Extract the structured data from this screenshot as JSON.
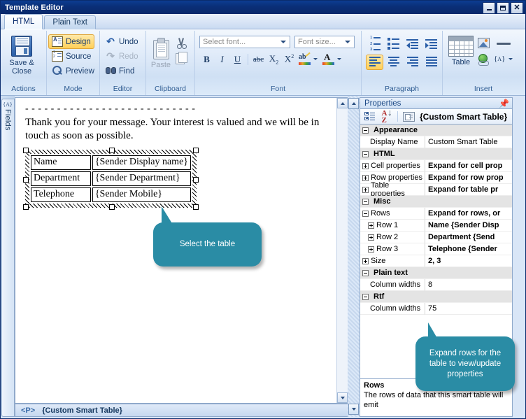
{
  "window": {
    "title": "Template Editor",
    "minimize_label": "Minimize",
    "maximize_label": "Maximize",
    "close_label": "Close"
  },
  "tabs": [
    {
      "label": "HTML",
      "active": true
    },
    {
      "label": "Plain Text",
      "active": false
    }
  ],
  "ribbon": {
    "groups": [
      {
        "label": "Actions",
        "buttons": [
          {
            "label": "Save &\nClose",
            "icon": "floppy-disk-icon"
          }
        ]
      },
      {
        "label": "Mode",
        "buttons": [
          {
            "label": "Design",
            "icon": "design-view-icon",
            "selected": true
          },
          {
            "label": "Source",
            "icon": "source-view-icon",
            "selected": false
          },
          {
            "label": "Preview",
            "icon": "magnifier-icon",
            "selected": false
          }
        ]
      },
      {
        "label": "Editor",
        "buttons": [
          {
            "label": "Undo",
            "icon": "undo-arrow-icon",
            "disabled": false
          },
          {
            "label": "Redo",
            "icon": "redo-arrow-icon",
            "disabled": true
          },
          {
            "label": "Find",
            "icon": "binoculars-icon",
            "disabled": false
          }
        ]
      },
      {
        "label": "Clipboard",
        "buttons": [
          {
            "label": "Paste",
            "icon": "clipboard-icon",
            "disabled": true
          },
          {
            "label": "",
            "icon": "scissors-icon"
          },
          {
            "label": "",
            "icon": "copy-icon"
          }
        ]
      },
      {
        "label": "Font",
        "font_name_placeholder": "Select font...",
        "font_size_placeholder": "Font size...",
        "buttons": [
          {
            "label": "B",
            "icon": "bold-icon"
          },
          {
            "label": "I",
            "icon": "italic-icon"
          },
          {
            "label": "U",
            "icon": "underline-icon"
          },
          {
            "label": "abc",
            "icon": "strikethrough-icon"
          },
          {
            "label": "X2",
            "icon": "subscript-icon"
          },
          {
            "label": "X2",
            "icon": "superscript-icon"
          },
          {
            "label": "",
            "icon": "highlight-color-icon"
          },
          {
            "label": "A",
            "icon": "font-color-icon"
          }
        ]
      },
      {
        "label": "Paragraph",
        "buttons": [
          {
            "icon": "numbered-list-icon"
          },
          {
            "icon": "bulleted-list-icon"
          },
          {
            "icon": "decrease-indent-icon"
          },
          {
            "icon": "increase-indent-icon"
          },
          {
            "icon": "align-left-icon",
            "selected": true
          },
          {
            "icon": "align-center-icon"
          },
          {
            "icon": "align-right-icon"
          },
          {
            "icon": "align-justify-icon"
          }
        ]
      },
      {
        "label": "Insert",
        "table_label": "Table",
        "buttons": [
          {
            "icon": "insert-table-icon",
            "label": "Table"
          },
          {
            "icon": "insert-image-icon"
          },
          {
            "icon": "horizontal-rule-icon"
          },
          {
            "icon": "insert-hyperlink-icon"
          },
          {
            "icon": "insert-field-icon",
            "label": "{A}"
          }
        ]
      }
    ]
  },
  "fields_rail": {
    "label": "Fields",
    "icon_label": "{A}"
  },
  "document": {
    "divider": "- - - - - - - - - - - - - - - - - - - - - - - - - - -",
    "paragraph": "Thank you for your message.  Your interest is valued and we will be in touch as soon as possible.",
    "table": {
      "rows": [
        {
          "label": "Name",
          "value": "{Sender Display name}"
        },
        {
          "label": "Department",
          "value": "{Sender Department}"
        },
        {
          "label": "Telephone",
          "value": "{Sender Mobile}"
        }
      ]
    }
  },
  "callouts": [
    {
      "id": "callout1",
      "text": "Select the table",
      "color": "#2a8ca5"
    },
    {
      "id": "callout2",
      "text": "Expand rows for the table to view/update properties",
      "color": "#2a8ca5"
    }
  ],
  "status_bar": {
    "element_tag": "<P>",
    "selection": "{Custom Smart Table}"
  },
  "properties_panel": {
    "title": "Properties",
    "pin_label": "Auto Hide",
    "toolbar": {
      "categorized_label": "Categorized",
      "alphabetical_label": "Alphabetical",
      "pages_label": "Property Pages"
    },
    "object_name": "{Custom Smart Table}",
    "grid": [
      {
        "kind": "category",
        "expander": "minus",
        "name": "Appearance"
      },
      {
        "kind": "prop",
        "expander": "none",
        "name": "Display Name",
        "value": "Custom Smart Table",
        "bold": false
      },
      {
        "kind": "category",
        "expander": "minus",
        "name": "HTML"
      },
      {
        "kind": "prop",
        "expander": "plus",
        "name": "Cell properties",
        "value": "Expand for cell prop",
        "bold": true
      },
      {
        "kind": "prop",
        "expander": "plus",
        "name": "Row properties",
        "value": "Expand for row prop",
        "bold": true
      },
      {
        "kind": "prop",
        "expander": "plus",
        "name": "Table properties",
        "value": "Expand for table pr",
        "bold": true
      },
      {
        "kind": "category",
        "expander": "minus",
        "name": "Misc"
      },
      {
        "kind": "prop",
        "expander": "minus",
        "name": "Rows",
        "value": "Expand for rows, or",
        "bold": true
      },
      {
        "kind": "prop",
        "expander": "plus",
        "name": "Row 1",
        "value": "Name {Sender Disp",
        "bold": true,
        "indent": true
      },
      {
        "kind": "prop",
        "expander": "plus",
        "name": "Row 2",
        "value": "Department {Send",
        "bold": true,
        "indent": true
      },
      {
        "kind": "prop",
        "expander": "plus",
        "name": "Row 3",
        "value": "Telephone {Sender",
        "bold": true,
        "indent": true
      },
      {
        "kind": "prop",
        "expander": "plus",
        "name": "Size",
        "value": "2, 3",
        "bold": true
      },
      {
        "kind": "category",
        "expander": "minus",
        "name": "Plain text"
      },
      {
        "kind": "prop",
        "expander": "none",
        "name": "Column widths",
        "value": "8",
        "bold": false
      },
      {
        "kind": "category",
        "expander": "minus",
        "name": "Rtf"
      },
      {
        "kind": "prop",
        "expander": "none",
        "name": "Column widths",
        "value": "75",
        "bold": false
      }
    ],
    "description": {
      "title": "Rows",
      "text": "The rows of data that this smart table will emit"
    }
  }
}
